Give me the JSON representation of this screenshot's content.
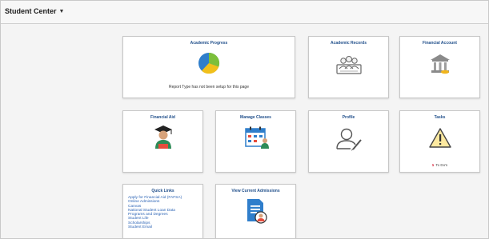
{
  "header": {
    "title": "Student Center",
    "caret": "▼"
  },
  "tiles": {
    "academic_progress": {
      "title": "Academic Progress",
      "message": "Report Type has not been setup for this page"
    },
    "academic_records": {
      "title": "Academic Records"
    },
    "financial_account": {
      "title": "Financial Account"
    },
    "financial_aid": {
      "title": "Financial Aid"
    },
    "manage_classes": {
      "title": "Manage Classes"
    },
    "profile": {
      "title": "Profile"
    },
    "tasks": {
      "title": "Tasks",
      "todo_count": "1",
      "todo_label": "To Do's"
    },
    "quick_links": {
      "title": "Quick Links",
      "links": [
        "Apply for Financial Aid (FAFSA)",
        "Online Admissions",
        "Canvas",
        "National Student Loan Data",
        "Programs and Degrees",
        "Student Life",
        "Scholarships",
        "Student Email"
      ]
    },
    "view_current_admissions": {
      "title": "View Current Admissions"
    }
  },
  "colors": {
    "tile_title": "#1f4e8a",
    "pie_blue": "#2f7ecb",
    "pie_green": "#7cbf3a",
    "pie_yellow": "#f1c01b",
    "warning_fill": "#fde9a0",
    "todo_flag": "#d0021b"
  },
  "icons": {
    "academic_progress": "pie-chart-icon",
    "academic_records": "records-people-icon",
    "financial_account": "bank-icon",
    "financial_aid": "graduate-icon",
    "manage_classes": "calendar-icon",
    "profile": "user-edit-icon",
    "tasks": "warning-icon",
    "view_current_admissions": "document-user-icon"
  }
}
